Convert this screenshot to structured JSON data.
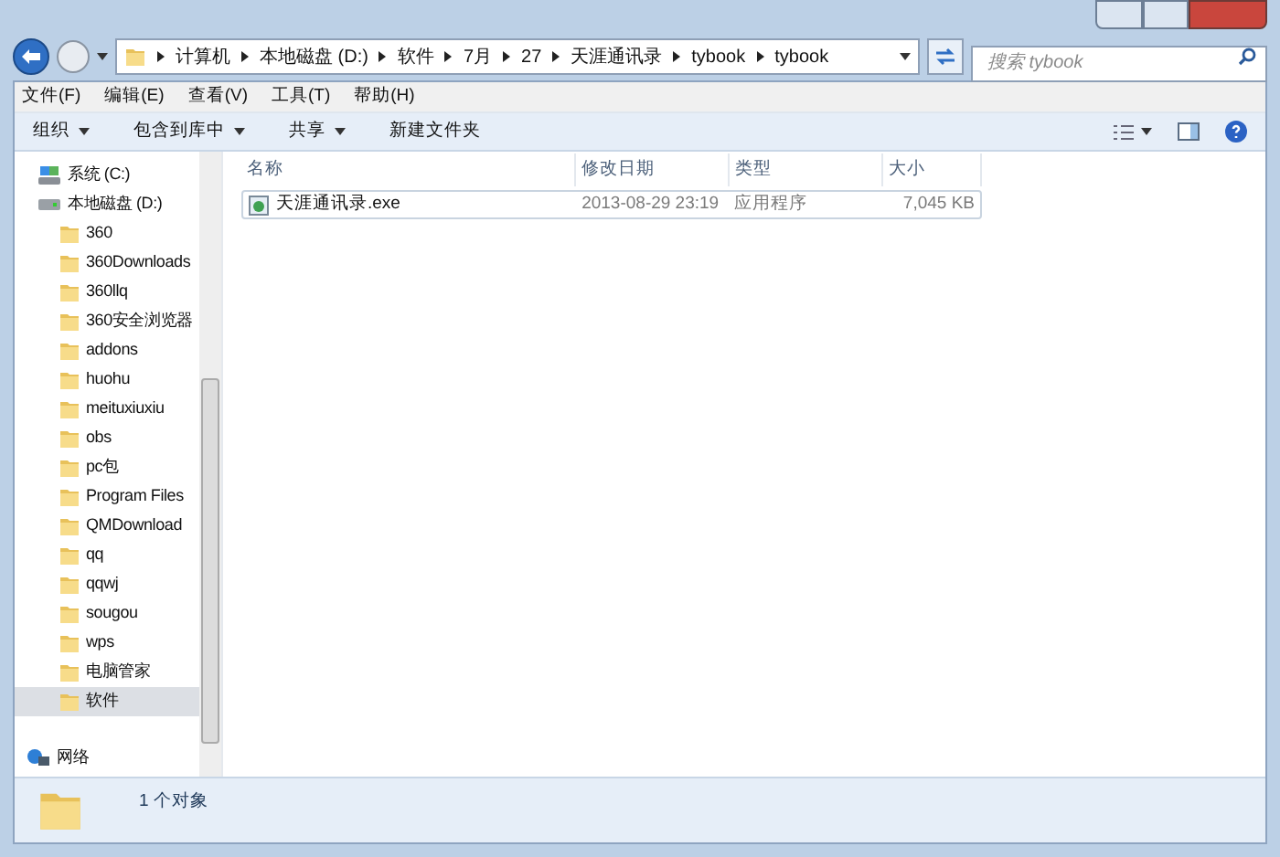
{
  "address": {
    "crumbs": [
      "计算机",
      "本地磁盘 (D:)",
      "软件",
      "7月",
      "27",
      "天涯通讯录",
      "tybook",
      "tybook"
    ]
  },
  "search": {
    "placeholder": "搜索 tybook"
  },
  "menu": [
    "文件(F)",
    "编辑(E)",
    "查看(V)",
    "工具(T)",
    "帮助(H)"
  ],
  "toolbar": [
    {
      "label": "组织",
      "has_menu": true
    },
    {
      "label": "包含到库中",
      "has_menu": true
    },
    {
      "label": "共享",
      "has_menu": true
    },
    {
      "label": "新建文件夹",
      "has_menu": false
    }
  ],
  "sidebar": {
    "items": [
      {
        "label": "系统 (C:)",
        "kind": "system-drive",
        "selected": false
      },
      {
        "label": "本地磁盘 (D:)",
        "kind": "drive",
        "selected": false,
        "children": [
          {
            "label": "360",
            "kind": "folder",
            "selected": false
          },
          {
            "label": "360Downloads",
            "kind": "folder",
            "selected": false
          },
          {
            "label": "360llq",
            "kind": "folder",
            "selected": false
          },
          {
            "label": "360安全浏览器",
            "kind": "folder",
            "selected": false
          },
          {
            "label": "addons",
            "kind": "folder",
            "selected": false
          },
          {
            "label": "huohu",
            "kind": "folder",
            "selected": false
          },
          {
            "label": "meituxiuxiu",
            "kind": "folder",
            "selected": false
          },
          {
            "label": "obs",
            "kind": "folder",
            "selected": false
          },
          {
            "label": "pc包",
            "kind": "folder",
            "selected": false
          },
          {
            "label": "Program Files",
            "kind": "folder",
            "selected": false
          },
          {
            "label": "QMDownload",
            "kind": "folder",
            "selected": false
          },
          {
            "label": "qq",
            "kind": "folder",
            "selected": false
          },
          {
            "label": "qqwj",
            "kind": "folder",
            "selected": false
          },
          {
            "label": "sougou",
            "kind": "folder",
            "selected": false
          },
          {
            "label": "wps",
            "kind": "folder",
            "selected": false
          },
          {
            "label": "电脑管家",
            "kind": "folder",
            "selected": false
          },
          {
            "label": "软件",
            "kind": "folder",
            "selected": true
          }
        ]
      }
    ],
    "network": {
      "label": "网络",
      "kind": "network",
      "selected": false
    }
  },
  "table": {
    "columns": [
      "名称",
      "修改日期",
      "类型",
      "大小"
    ],
    "rows": [
      {
        "cells": [
          "天涯通讯录.exe",
          "2013-08-29 23:19",
          "应用程序",
          "7,045 KB"
        ],
        "selected": false
      }
    ]
  },
  "status_bar": {
    "text": "1 个对象"
  }
}
